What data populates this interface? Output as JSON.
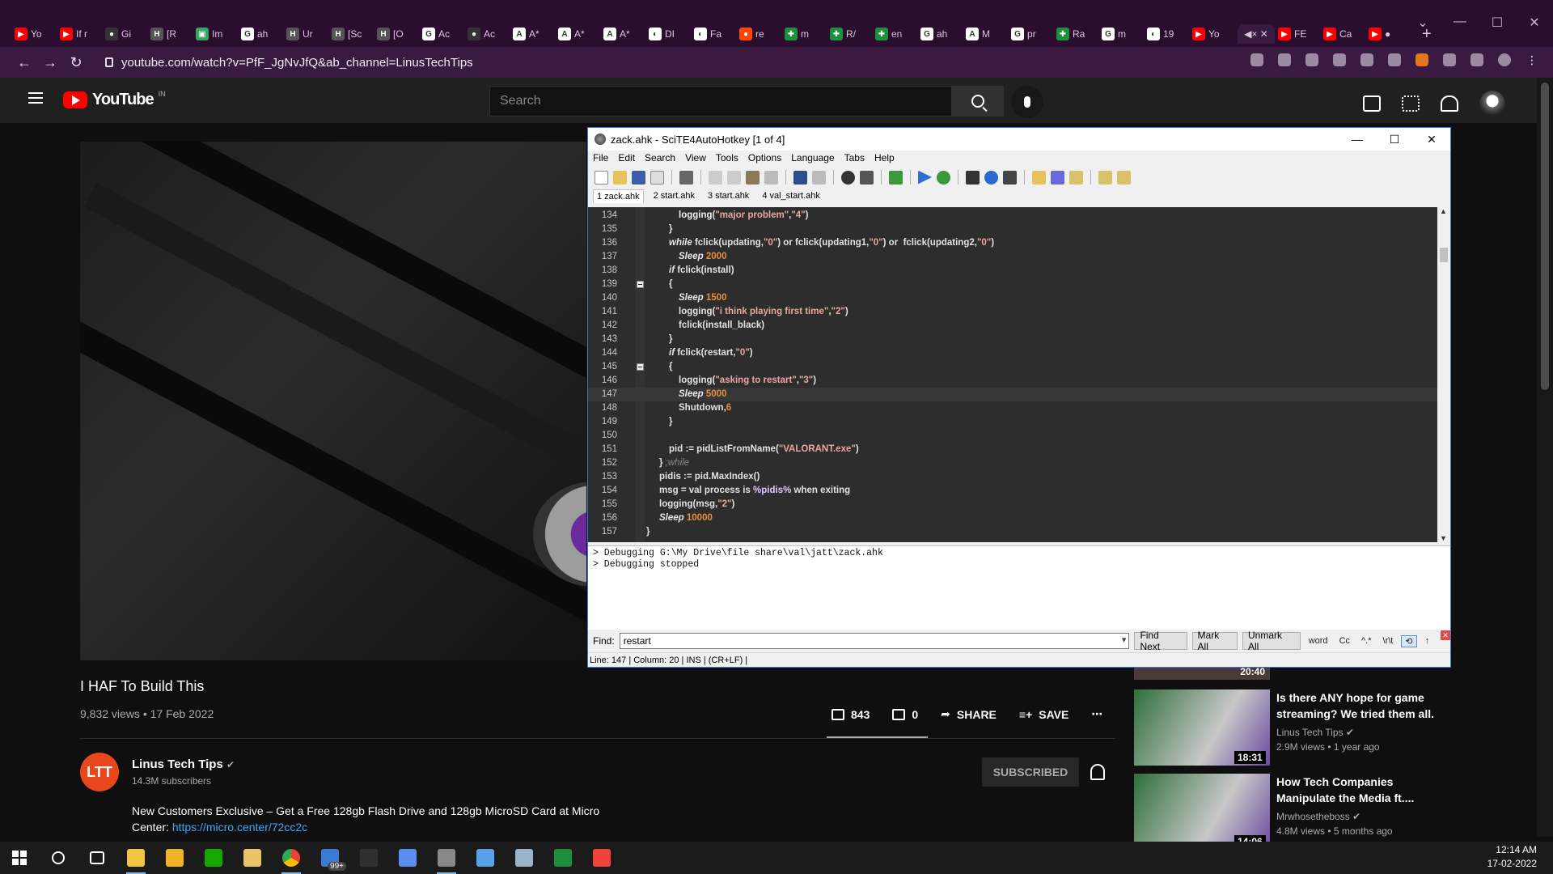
{
  "browser": {
    "tabs": [
      {
        "label": "Yo",
        "color": "#ff0000",
        "glyph": "▶"
      },
      {
        "label": "If r",
        "color": "#ff0000",
        "glyph": "▶"
      },
      {
        "label": "Gi",
        "color": "#333333",
        "glyph": "●"
      },
      {
        "label": "[R",
        "color": "#555555",
        "glyph": "H"
      },
      {
        "label": "Im",
        "color": "#3aa35f",
        "glyph": "▣"
      },
      {
        "label": "ah",
        "color": "#ffffff",
        "glyph": "G"
      },
      {
        "label": "Ur",
        "color": "#555555",
        "glyph": "H"
      },
      {
        "label": "[Sc",
        "color": "#555555",
        "glyph": "H"
      },
      {
        "label": "[O",
        "color": "#555555",
        "glyph": "H"
      },
      {
        "label": "Ac",
        "color": "#ffffff",
        "glyph": "G"
      },
      {
        "label": "Ac",
        "color": "#333333",
        "glyph": "●"
      },
      {
        "label": "A*",
        "color": "#ffffff",
        "glyph": "A"
      },
      {
        "label": "A*",
        "color": "#ffffff",
        "glyph": "A"
      },
      {
        "label": "A*",
        "color": "#ffffff",
        "glyph": "A"
      },
      {
        "label": "DI",
        "color": "#ffffff",
        "glyph": "◐"
      },
      {
        "label": "Fa",
        "color": "#ffffff",
        "glyph": "◐"
      },
      {
        "label": "re",
        "color": "#ff4500",
        "glyph": "●"
      },
      {
        "label": "m",
        "color": "#1e8e3e",
        "glyph": "✚"
      },
      {
        "label": "R/",
        "color": "#1e8e3e",
        "glyph": "✚"
      },
      {
        "label": "en",
        "color": "#1e8e3e",
        "glyph": "✚"
      },
      {
        "label": "ah",
        "color": "#ffffff",
        "glyph": "G"
      },
      {
        "label": "M",
        "color": "#ffffff",
        "glyph": "A"
      },
      {
        "label": "pr",
        "color": "#ffffff",
        "glyph": "G"
      },
      {
        "label": "Ra",
        "color": "#1e8e3e",
        "glyph": "✚"
      },
      {
        "label": "m",
        "color": "#ffffff",
        "glyph": "G"
      },
      {
        "label": "19",
        "color": "#ffffff",
        "glyph": "◐"
      },
      {
        "label": "Yo",
        "color": "#ff0000",
        "glyph": "▶"
      }
    ],
    "active_tab": {
      "label": "◀× ✕"
    },
    "tabs_after": [
      {
        "label": "FE",
        "color": "#ff0000",
        "glyph": "▶"
      },
      {
        "label": "Ca",
        "color": "#ff0000",
        "glyph": "▶"
      },
      {
        "label": "●",
        "color": "#ff0000",
        "glyph": "▶"
      }
    ],
    "url": "youtube.com/watch?v=PfF_JgNvJfQ&ab_channel=LinusTechTips"
  },
  "youtube": {
    "logo_text": "YouTube",
    "country": "IN",
    "search_placeholder": "Search",
    "video_title": "I HAF To Build This",
    "video_meta": "9,832 views • 17 Feb 2022",
    "likes": "843",
    "dislikes": "0",
    "share_label": "SHARE",
    "save_label": "SAVE",
    "channel_name": "Linus Tech Tips",
    "channel_subs": "14.3M subscribers",
    "subscribed_label": "SUBSCRIBED",
    "description": "New Customers Exclusive – Get a Free 128gb Flash Drive and 128gb MicroSD Card at Micro Center:",
    "description_link": "https://micro.center/72cc2c",
    "rec0_duration": "20:40",
    "recommendations": [
      {
        "title": "Is there ANY hope for game streaming? We tried them all.",
        "channel": "Linus Tech Tips",
        "views": "2.9M views • 1 year ago",
        "duration": "18:31"
      },
      {
        "title": "How Tech Companies Manipulate the Media ft....",
        "channel": "Mrwhosetheboss",
        "views": "4.8M views • 5 months ago",
        "duration": "14:06"
      }
    ]
  },
  "scite": {
    "title": "zack.ahk - SciTE4AutoHotkey [1 of 4]",
    "menu": [
      "File",
      "Edit",
      "Search",
      "View",
      "Tools",
      "Options",
      "Language",
      "Tabs",
      "Help"
    ],
    "tabs": [
      "1 zack.ahk",
      "2 start.ahk",
      "3 start.ahk",
      "4 val_start.ahk"
    ],
    "lines": [
      {
        "n": "134",
        "indent": 2,
        "html": "<span class='fn'>logging</span>(<span class='str'>\"major problem\"</span>,<span class='str'>\"4\"</span>)"
      },
      {
        "n": "135",
        "indent": 1,
        "html": "}"
      },
      {
        "n": "136",
        "indent": 1,
        "html": "<span class='kw'>while</span> fclick(updating,<span class='str'>\"0\"</span>) or fclick(updating1,<span class='str'>\"0\"</span>) or  fclick(updating2,<span class='str'>\"0\"</span>)"
      },
      {
        "n": "137",
        "indent": 2,
        "html": "<span class='kw'>Sleep</span> <span class='num'>2000</span>"
      },
      {
        "n": "138",
        "indent": 1,
        "html": "<span class='kw'>if</span> fclick(install)"
      },
      {
        "n": "139",
        "indent": 1,
        "html": "{"
      },
      {
        "n": "140",
        "indent": 2,
        "html": "<span class='kw'>Sleep</span> <span class='num'>1500</span>"
      },
      {
        "n": "141",
        "indent": 2,
        "html": "logging(<span class='str'>\"i think playing first time\"</span>,<span class='str'>\"2\"</span>)"
      },
      {
        "n": "142",
        "indent": 2,
        "html": "fclick(install_black)"
      },
      {
        "n": "143",
        "indent": 1,
        "html": "}"
      },
      {
        "n": "144",
        "indent": 1,
        "html": "<span class='kw'>if</span> fclick(restart,<span class='str'>\"0\"</span>)"
      },
      {
        "n": "145",
        "indent": 1,
        "html": "{"
      },
      {
        "n": "146",
        "indent": 2,
        "html": "logging(<span class='str'>\"asking to restart\"</span>,<span class='str'>\"3\"</span>)"
      },
      {
        "n": "147",
        "indent": 2,
        "html": "<span class='kw'>Sleep</span> <span class='num'>5000</span>"
      },
      {
        "n": "148",
        "indent": 2,
        "html": "Shutdown,<span class='num'>6</span>"
      },
      {
        "n": "149",
        "indent": 1,
        "html": "}"
      },
      {
        "n": "150",
        "indent": 1,
        "html": ""
      },
      {
        "n": "151",
        "indent": 1,
        "html": "pid := pidListFromName(<span class='str'>\"VALORANT.exe\"</span>)"
      },
      {
        "n": "152",
        "indent": 0,
        "html": "} <span class='cmt'>;while</span>"
      },
      {
        "n": "153",
        "indent": 0,
        "html": "pidis := pid.MaxIndex()"
      },
      {
        "n": "154",
        "indent": 0,
        "html": "msg = val process is <span class='var'>%pidis%</span> when exiting"
      },
      {
        "n": "155",
        "indent": 0,
        "html": "logging(msg,<span class='str'>\"2\"</span>)"
      },
      {
        "n": "156",
        "indent": 0,
        "html": "<span class='kw'>Sleep</span> <span class='num'>10000</span>"
      },
      {
        "n": "157",
        "indent": -1,
        "html": "}"
      }
    ],
    "current_line": "147",
    "output": "> Debugging G:\\My Drive\\file share\\val\\jatt\\zack.ahk\n> Debugging stopped",
    "find_label": "Find:",
    "find_value": "restart",
    "find_next": "Find Next",
    "mark_all": "Mark All",
    "unmark_all": "Unmark All",
    "find_opts": [
      "word",
      "Cc",
      "^.*",
      "\\r\\t"
    ],
    "status": "Line: 147 | Column: 20 | INS | (CR+LF) |"
  },
  "taskbar": {
    "icons": [
      {
        "name": "search-icon",
        "color": "#ffffff"
      },
      {
        "name": "task-view-icon",
        "color": "#ffffff"
      },
      {
        "name": "file-explorer-icon",
        "color": "#f4c542",
        "open": true
      },
      {
        "name": "folder-icon",
        "color": "#f0b429"
      },
      {
        "name": "upwork-icon",
        "color": "#14a800"
      },
      {
        "name": "notes-icon",
        "color": "#e9c46a"
      },
      {
        "name": "chrome-icon",
        "color": "#4285f4",
        "open": true
      },
      {
        "name": "mail-icon",
        "color": "#3a7bd5",
        "badge": "99+"
      },
      {
        "name": "terminal-icon",
        "color": "#2f2f2f"
      },
      {
        "name": "browser-icon",
        "color": "#5b8def"
      },
      {
        "name": "scite-icon",
        "color": "#888888",
        "open": true
      },
      {
        "name": "window-icon",
        "color": "#5aa0e8"
      },
      {
        "name": "tool-icon",
        "color": "#9bb3c7"
      },
      {
        "name": "sheets-icon",
        "color": "#1e8e3e"
      },
      {
        "name": "anydesk-icon",
        "color": "#ef443b"
      }
    ],
    "time": "12:14 AM",
    "date": "17-02-2022"
  }
}
